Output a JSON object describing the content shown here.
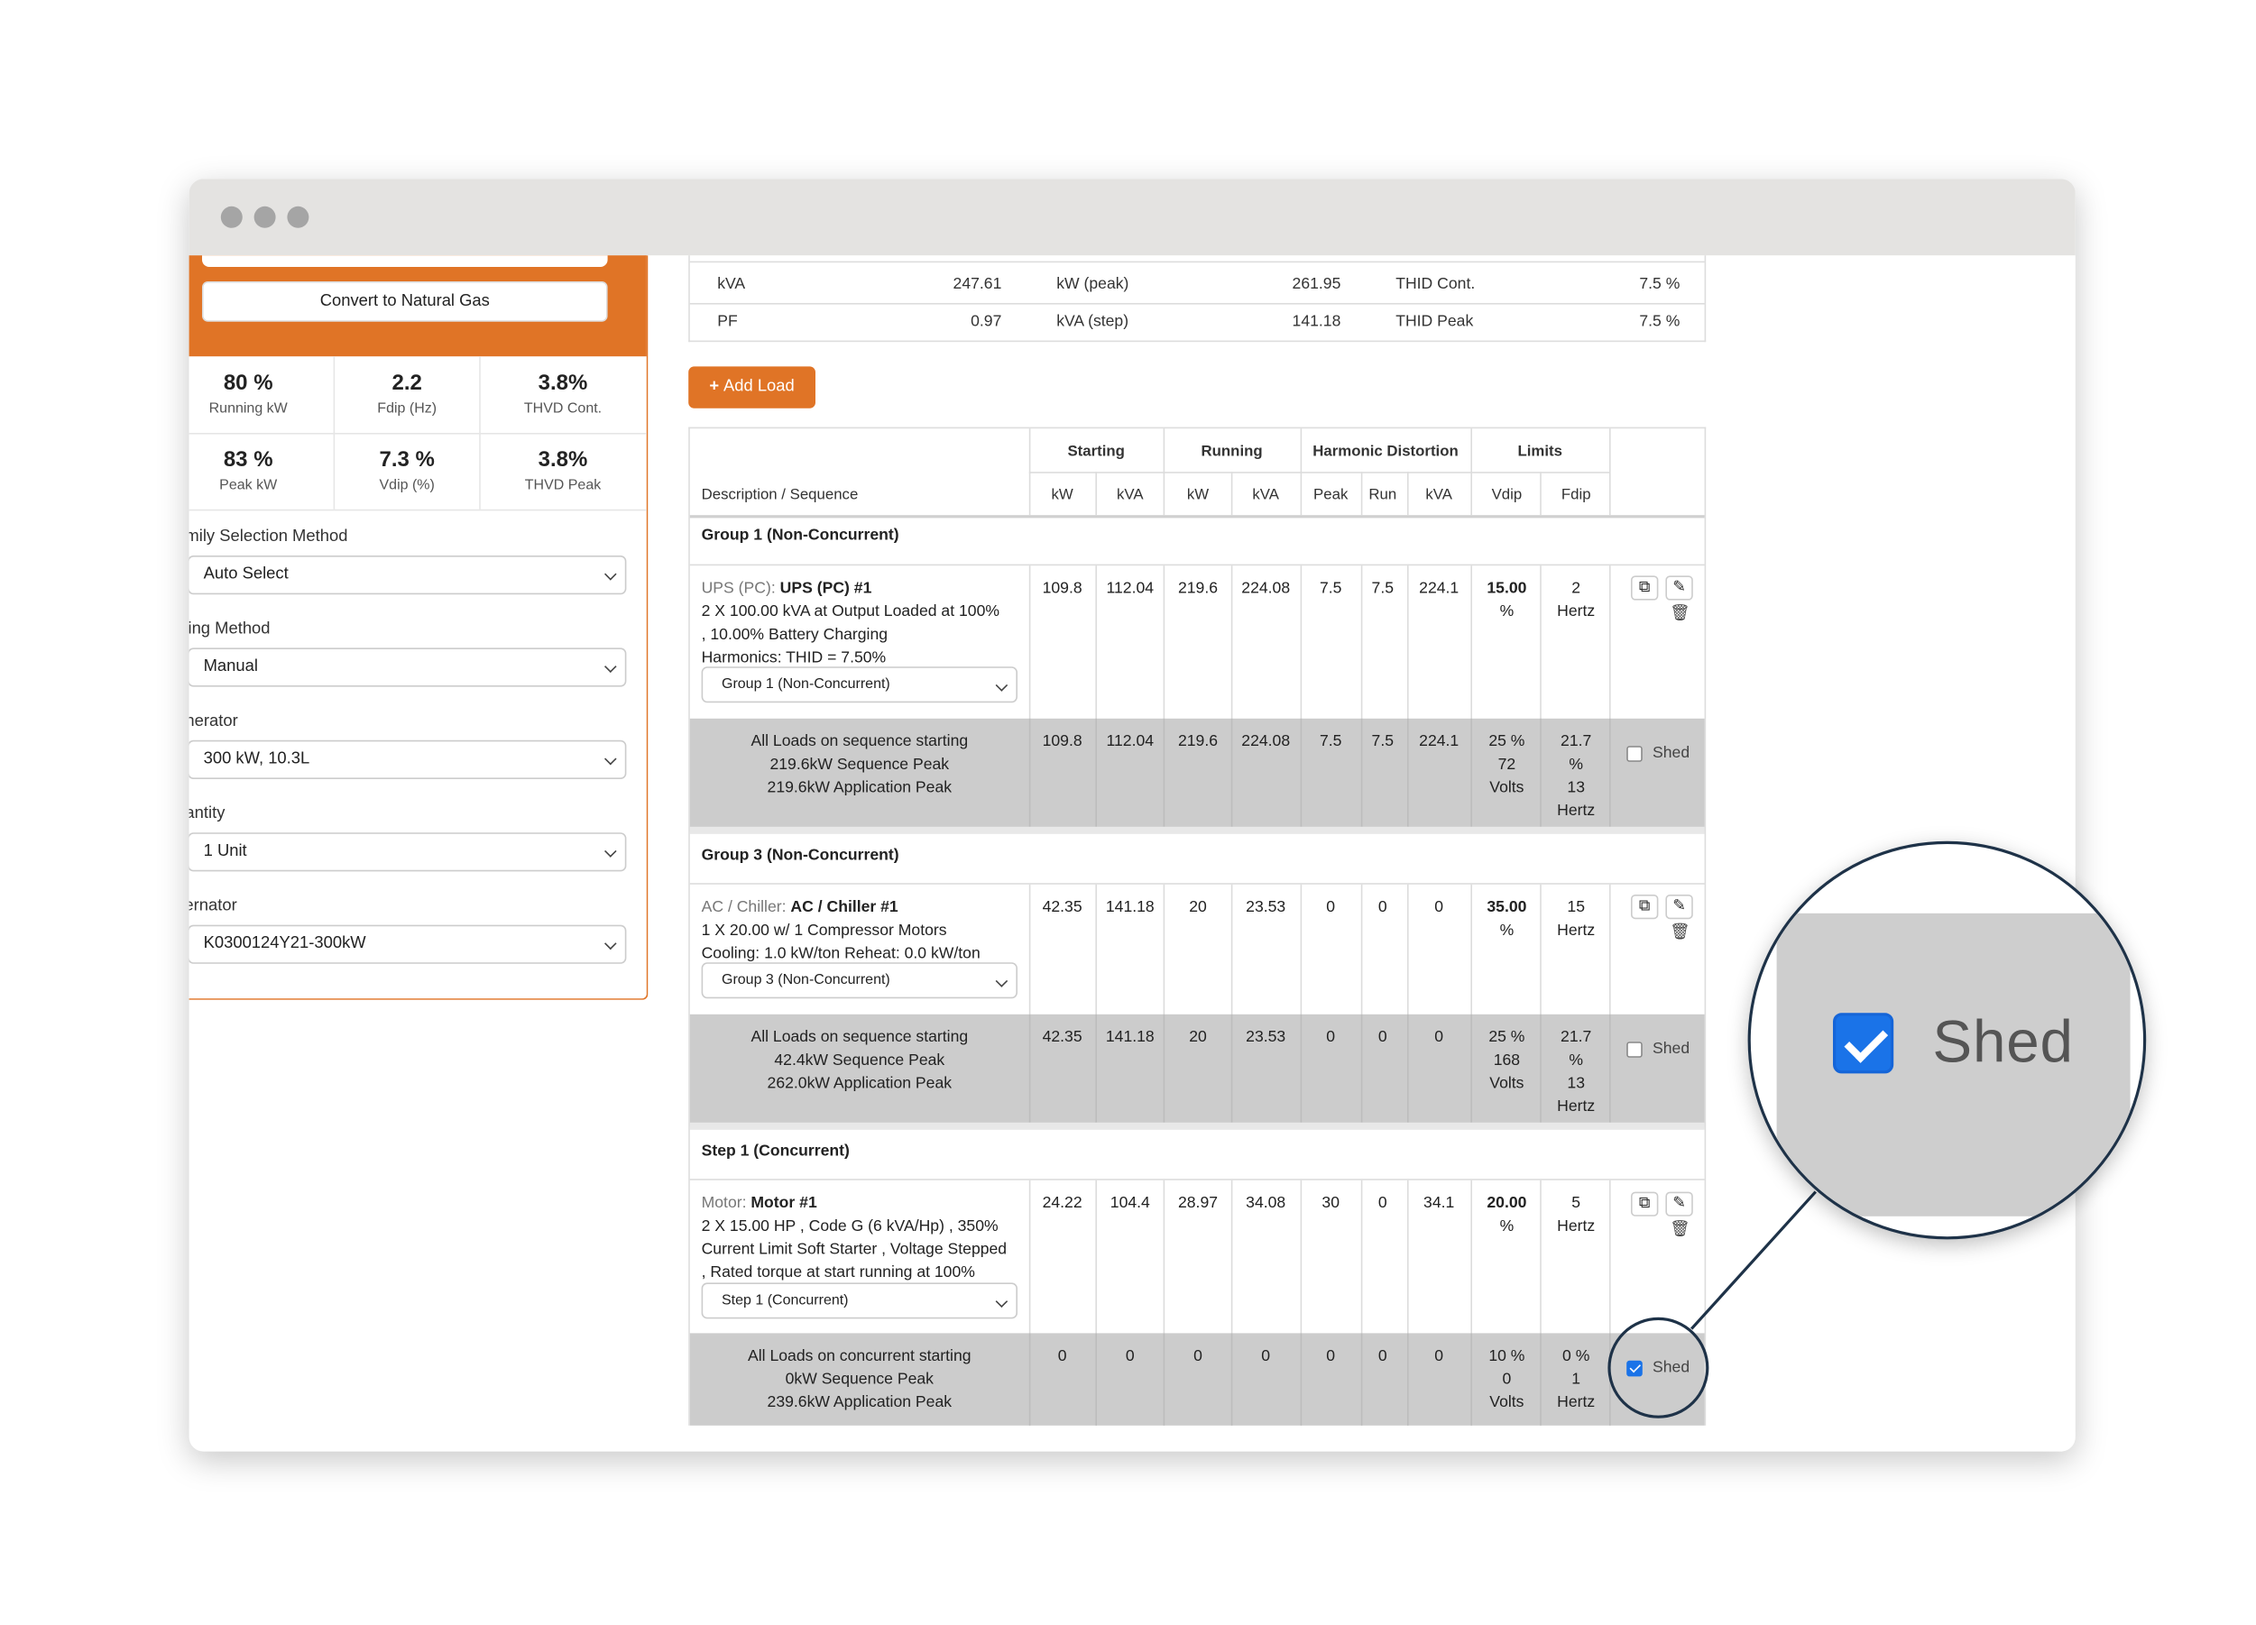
{
  "sidebar": {
    "convert_button": "Convert to Natural Gas",
    "stats": [
      {
        "value": "80 %",
        "label": "Running kW"
      },
      {
        "value": "2.2",
        "label": "Fdip (Hz)"
      },
      {
        "value": "3.8%",
        "label": "THVD Cont."
      },
      {
        "value": "83 %",
        "label": "Peak kW"
      },
      {
        "value": "7.3 %",
        "label": "Vdip (%)"
      },
      {
        "value": "3.8%",
        "label": "THVD Peak"
      }
    ],
    "fields": [
      {
        "label": "amily Selection Method",
        "value": "Auto Select"
      },
      {
        "label": "izing Method",
        "value": "Manual"
      },
      {
        "label": "enerator",
        "value": "300 kW, 10.3L"
      },
      {
        "label": "uantity",
        "value": "1 Unit"
      },
      {
        "label": "lternator",
        "value": "K0300124Y21-300kW"
      }
    ]
  },
  "summary": {
    "rows": [
      {
        "a_label": "kVA",
        "a_value": "247.61",
        "b_label": "kW (peak)",
        "b_value": "261.95",
        "c_label": "THID Cont.",
        "c_value": "7.5 %"
      },
      {
        "a_label": "PF",
        "a_value": "0.97",
        "b_label": "kVA (step)",
        "b_value": "141.18",
        "c_label": "THID Peak",
        "c_value": "7.5 %"
      }
    ]
  },
  "add_load_label": "Add Load",
  "table": {
    "group_headers": [
      "Starting",
      "Running",
      "Harmonic Distortion",
      "Limits"
    ],
    "desc_header": "Description / Sequence",
    "columns": [
      "kW",
      "kVA",
      "kW",
      "kVA",
      "Peak",
      "Run",
      "kVA",
      "Vdip",
      "Fdip"
    ],
    "shed_label": "Shed",
    "groups": [
      {
        "title": "Group 1 (Non-Concurrent)",
        "item": {
          "type": "UPS (PC):",
          "name": "UPS (PC) #1",
          "lines": [
            "2 X 100.00 kVA at Output Loaded at 100%",
            ", 10.00% Battery Charging",
            "Harmonics: THID = 7.50%"
          ],
          "sequence": "Group 1 (Non-Concurrent)",
          "values": [
            "109.8",
            "112.04",
            "219.6",
            "224.08",
            "7.5",
            "7.5",
            "224.1"
          ],
          "vdip": [
            "15.00",
            "%"
          ],
          "fdip": [
            "2",
            "Hertz"
          ]
        },
        "summary": {
          "lines": [
            "All Loads on sequence starting",
            "219.6kW Sequence Peak",
            "219.6kW Application Peak"
          ],
          "values": [
            "109.8",
            "112.04",
            "219.6",
            "224.08",
            "7.5",
            "7.5",
            "224.1"
          ],
          "vdip": [
            "25 %",
            "72",
            "Volts"
          ],
          "fdip": [
            "21.7",
            "%",
            "13",
            "Hertz"
          ],
          "shed": false
        }
      },
      {
        "title": "Group 3 (Non-Concurrent)",
        "item": {
          "type": "AC / Chiller:",
          "name": "AC / Chiller #1",
          "lines": [
            "1 X 20.00 w/ 1 Compressor Motors",
            "Cooling: 1.0 kW/ton Reheat: 0.0 kW/ton"
          ],
          "sequence": "Group 3 (Non-Concurrent)",
          "values": [
            "42.35",
            "141.18",
            "20",
            "23.53",
            "0",
            "0",
            "0"
          ],
          "vdip": [
            "35.00",
            "%"
          ],
          "fdip": [
            "15",
            "Hertz"
          ]
        },
        "summary": {
          "lines": [
            "All Loads on sequence starting",
            "42.4kW Sequence Peak",
            "262.0kW Application Peak"
          ],
          "values": [
            "42.35",
            "141.18",
            "20",
            "23.53",
            "0",
            "0",
            "0"
          ],
          "vdip": [
            "25 %",
            "168",
            "Volts"
          ],
          "fdip": [
            "21.7",
            "%",
            "13",
            "Hertz"
          ],
          "shed": false
        }
      },
      {
        "title": "Step 1 (Concurrent)",
        "item": {
          "type": "Motor:",
          "name": "Motor #1",
          "lines": [
            "2 X 15.00 HP , Code G (6 kVA/Hp) , 350%",
            "Current Limit Soft Starter , Voltage Stepped",
            ", Rated torque at start running at 100%"
          ],
          "sequence": "Step 1 (Concurrent)",
          "values": [
            "24.22",
            "104.4",
            "28.97",
            "34.08",
            "30",
            "0",
            "34.1"
          ],
          "vdip": [
            "20.00",
            "%"
          ],
          "fdip": [
            "5",
            "Hertz"
          ]
        },
        "summary": {
          "lines": [
            "All Loads on concurrent starting",
            "0kW Sequence Peak",
            "239.6kW Application Peak"
          ],
          "values": [
            "0",
            "0",
            "0",
            "0",
            "0",
            "0",
            "0"
          ],
          "vdip": [
            "10 %",
            "0",
            "Volts"
          ],
          "fdip": [
            "0 %",
            "1",
            "Hertz"
          ],
          "shed": true
        }
      }
    ]
  },
  "magnifier": {
    "label": "Shed",
    "checked": true
  },
  "colors": {
    "accent": "#e07426",
    "checkbox": "#1a73e8",
    "summary_row": "#cccccc",
    "magnifier_ring": "#1e3248"
  }
}
